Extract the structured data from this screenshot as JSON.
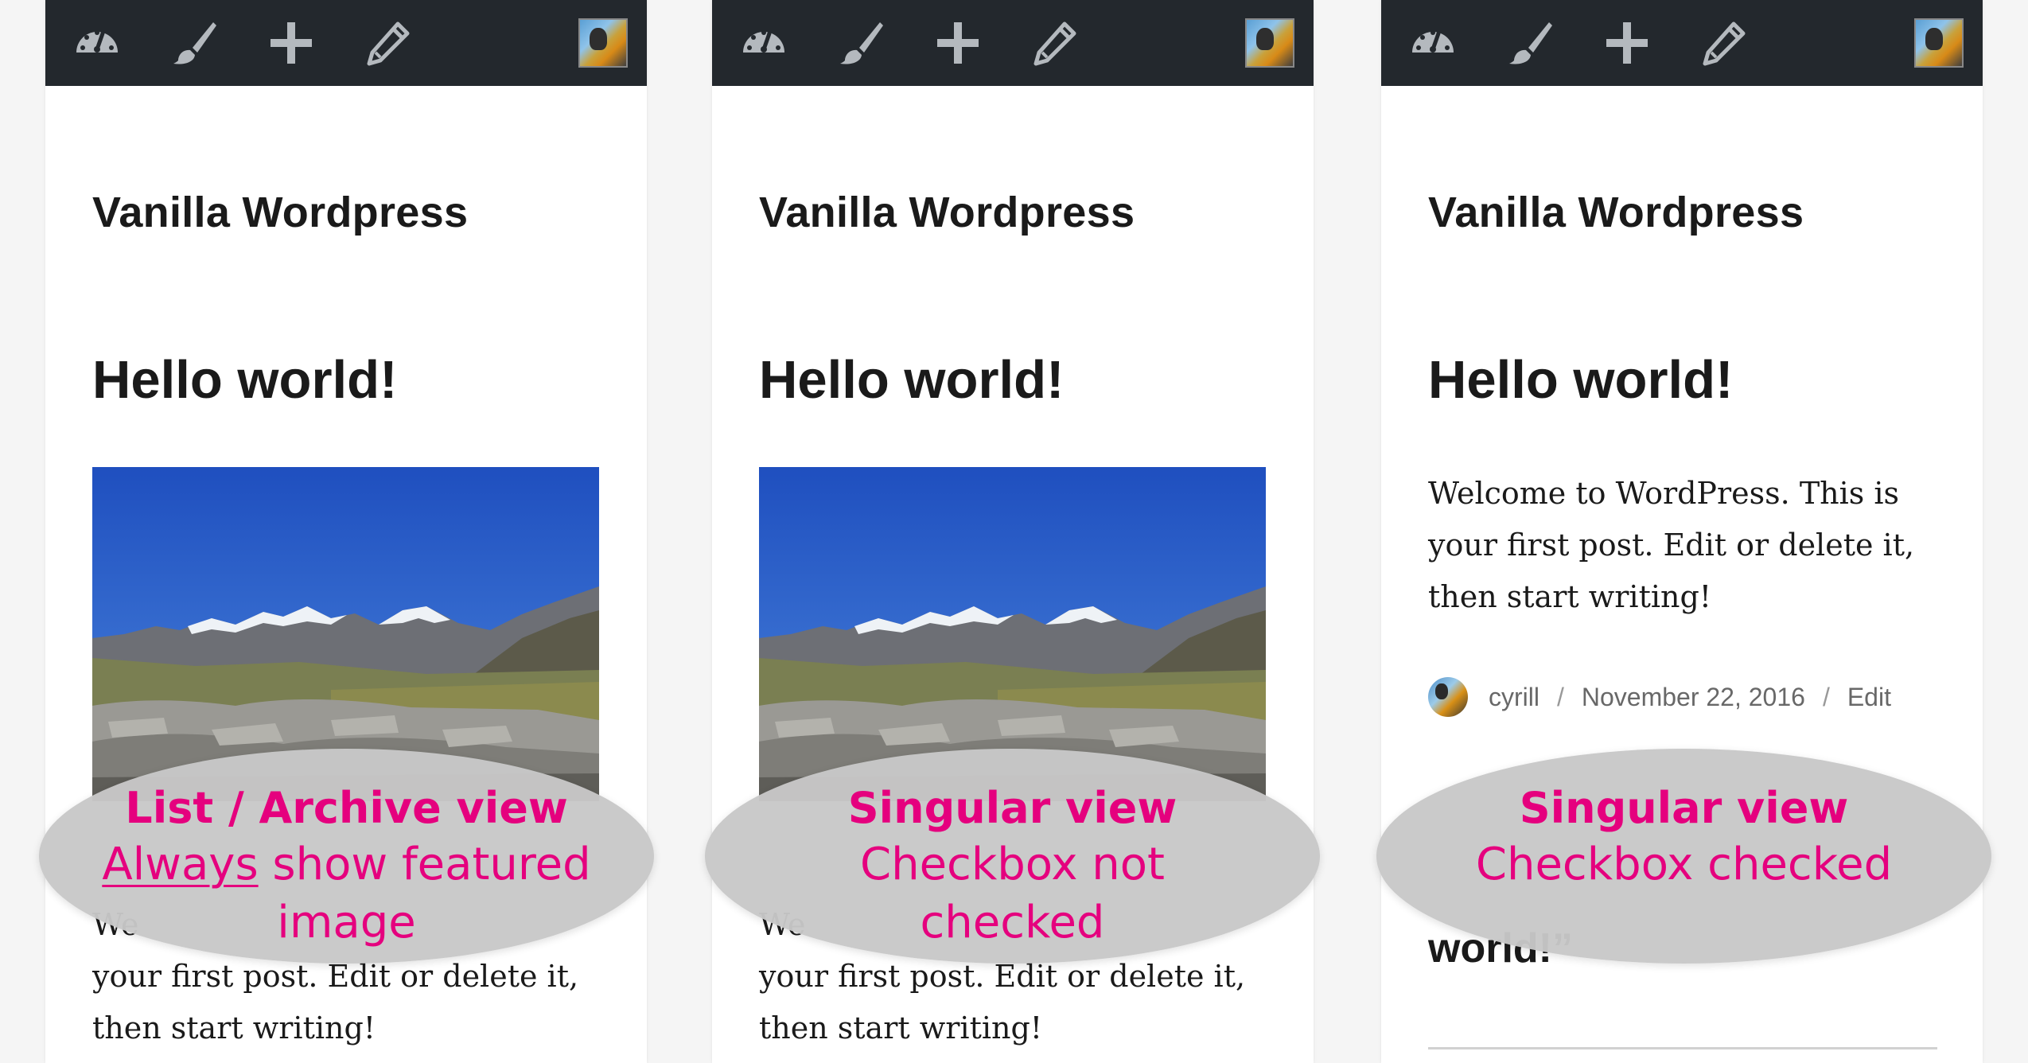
{
  "panels": [
    {
      "site_title": "Vanilla Wordpress",
      "post_title": "Hello world!",
      "excerpt_partial": "We",
      "excerpt_line2": "your first post. Edit or delete it,",
      "excerpt_line3": "then start writing!",
      "overlay": {
        "title": "List / Archive view",
        "emphasis": "Always",
        "line1_rest": " show featured",
        "line2": "image"
      }
    },
    {
      "site_title": "Vanilla Wordpress",
      "post_title": "Hello world!",
      "excerpt_partial": "We",
      "excerpt_line2": "your first post. Edit or delete it,",
      "excerpt_line3": "then start writing!",
      "overlay": {
        "title": "Singular view",
        "line1": "Checkbox not",
        "line2": "checked"
      }
    },
    {
      "site_title": "Vanilla Wordpress",
      "post_title": "Hello world!",
      "content_line1": "Welcome to WordPress. This is",
      "content_line2": "your first post. Edit or delete it,",
      "content_line3": "then start writing!",
      "meta": {
        "author": "cyrill",
        "separator": "/",
        "date": "November 22, 2016",
        "edit": "Edit"
      },
      "quote_partial": "world!”",
      "overlay": {
        "title": "Singular view",
        "line1": "Checkbox checked"
      }
    }
  ],
  "admin_bar_icons": [
    "dashboard-icon",
    "customize-brush-icon",
    "plus-icon",
    "edit-pencil-icon"
  ],
  "colors": {
    "admin_bar": "#23282d",
    "accent_magenta": "#e5007e",
    "overlay_gray": "#c8c8c8",
    "text": "#1a1a1a",
    "meta_text": "#686868"
  }
}
